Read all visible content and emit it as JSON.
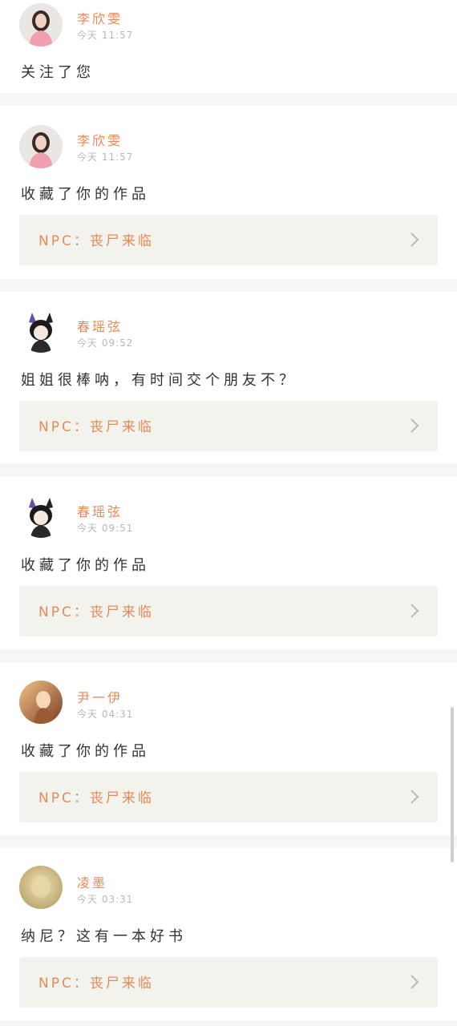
{
  "notifications": [
    {
      "avatar": "avatar-girl-pink",
      "username": "李欣雯",
      "time": "今天 11:57",
      "message": "关注了您",
      "work_label": ""
    },
    {
      "avatar": "avatar-girl-pink",
      "username": "李欣雯",
      "time": "今天 11:57",
      "message": "收藏了你的作品",
      "work_label": "NPC：丧尸来临"
    },
    {
      "avatar": "avatar-cat-ears",
      "username": "春瑶弦",
      "time": "今天 09:52",
      "message": "姐姐很棒呐，有时间交个朋友不？",
      "work_label": "NPC：丧尸来临"
    },
    {
      "avatar": "avatar-cat-ears",
      "username": "春瑶弦",
      "time": "今天 09:51",
      "message": "收藏了你的作品",
      "work_label": "NPC：丧尸来临"
    },
    {
      "avatar": "avatar-anime-warm",
      "username": "尹一伊",
      "time": "今天 04:31",
      "message": "收藏了你的作品",
      "work_label": "NPC：丧尸来临"
    },
    {
      "avatar": "avatar-blurred-gold",
      "username": "凌墨",
      "time": "今天 03:31",
      "message": "纳尼？这有一本好书",
      "work_label": "NPC：丧尸来临"
    }
  ],
  "icons": {
    "open_work": "chevron-right-icon"
  },
  "colors": {
    "accent": "#e58a5a",
    "muted": "#b8b8b8",
    "card_bg": "#f3f3ee"
  }
}
